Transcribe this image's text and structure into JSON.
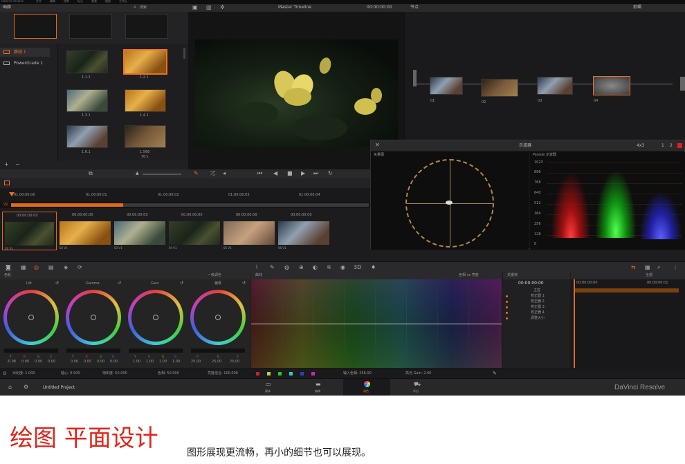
{
  "menubar": {
    "app": "DaVinci Resolve",
    "items": [
      "文件",
      "编辑",
      "修剪",
      "标记",
      "查看",
      "播放",
      "工作区",
      "帮助"
    ]
  },
  "gallery": {
    "title": "画廊",
    "items": [
      "静帧 1",
      "PowerGrade 1"
    ],
    "stills": [
      "1.1.1",
      "1.2.1",
      "1.3.1",
      "1.4.1",
      "1.6.1",
      "1.568"
    ],
    "still_sub": "70's"
  },
  "search": {
    "placeholder": "搜索"
  },
  "viewer": {
    "timeline": "Master Timeline",
    "timecode": "00:00:00:00"
  },
  "nodes": {
    "title": "节点",
    "right": "剪辑",
    "labels": [
      "01",
      "02",
      "03",
      "04"
    ]
  },
  "scopes": {
    "title": "示波器",
    "mode": "4x3",
    "pages": [
      "1",
      "2"
    ],
    "left": "矢量图",
    "right": "Parade 示波器",
    "axis": [
      "1023",
      "896",
      "768",
      "640",
      "512",
      "384",
      "256",
      "128",
      "0"
    ]
  },
  "timeline": {
    "ruler": [
      "01:00:00:00",
      "01:00:00:01",
      "01:00:00:02",
      "01:00:00:03",
      "01:00:00:04"
    ],
    "track": "V1",
    "clips": [
      {
        "tc": "00:00:00:00",
        "label": "01 V1"
      },
      {
        "tc": "00:00:00:00",
        "label": "02 V1"
      },
      {
        "tc": "00:00:00:00",
        "label": "03 V1"
      },
      {
        "tc": "00:00:00:00",
        "label": "04 V1"
      },
      {
        "tc": "00:00:00:00",
        "label": "05 V1"
      },
      {
        "tc": "00:00:00:00",
        "label": "06 V1"
      }
    ]
  },
  "color": {
    "title": "色轮",
    "mode": "一级调色",
    "wheels": [
      {
        "name": "Lift",
        "vals": [
          "-0.08",
          "0.00",
          "0.00",
          "0.00"
        ]
      },
      {
        "name": "Gamma",
        "vals": [
          "0.00",
          "0.00",
          "0.00",
          "0.00"
        ]
      },
      {
        "name": "Gain",
        "vals": [
          "1.00",
          "1.00",
          "1.00",
          "1.00"
        ]
      },
      {
        "name": "偏移",
        "vals": [
          "25.00",
          "25.00",
          "25.00",
          "25.00"
        ]
      }
    ],
    "chan": [
      "Y",
      "R",
      "G",
      "B"
    ]
  },
  "curves": {
    "title": "曲线",
    "mode": "色相 vs 亮度",
    "bottom": [
      "输入色相: 256.00",
      "高光 Gain: 2.00"
    ]
  },
  "keyframes": {
    "title": "关键帧",
    "timecode": "00:00:00:00",
    "rows": [
      "主控",
      "校正器 1",
      "校正器 2",
      "校正器 3",
      "校正器 4",
      "调整大小"
    ]
  },
  "keyframes_right": {
    "title": "全部",
    "tc1": "00:00:00:00",
    "tc2": "00:00:00:01"
  },
  "statusbar": {
    "items": [
      "对比度: 1.000",
      "轴心: 0.500",
      "饱和度: 50.000",
      "色相: 50.000",
      "亮度混合: 100.000"
    ]
  },
  "pagebar": {
    "project": "Untitled Project",
    "pages": [
      "媒体",
      "编辑",
      "调色",
      "导出"
    ],
    "brand": "DaVinci Resolve"
  },
  "caption": {
    "big": "绘图 平面设计",
    "small": "图形展现更流畅，再小的细节也可以展现。"
  },
  "colors": {
    "accent": "#f07020",
    "bg": "#1d1d1f",
    "caption_red": "#e2231a"
  }
}
